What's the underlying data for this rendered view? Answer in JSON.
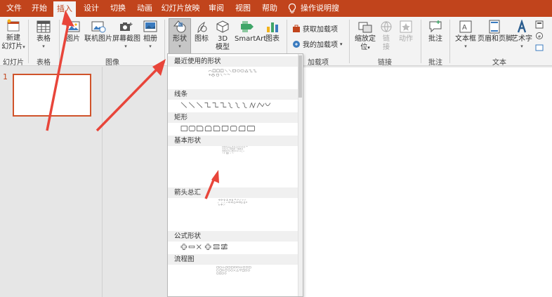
{
  "tabs": [
    {
      "id": "file",
      "label": "文件"
    },
    {
      "id": "home",
      "label": "开始"
    },
    {
      "id": "insert",
      "label": "插入",
      "active": true
    },
    {
      "id": "design",
      "label": "设计"
    },
    {
      "id": "transitions",
      "label": "切换"
    },
    {
      "id": "animations",
      "label": "动画"
    },
    {
      "id": "slideshow",
      "label": "幻灯片放映"
    },
    {
      "id": "review",
      "label": "审阅"
    },
    {
      "id": "view",
      "label": "视图"
    },
    {
      "id": "help",
      "label": "帮助"
    }
  ],
  "tell_me": "操作说明搜索",
  "ribbon": {
    "new_slide": {
      "line1": "新建",
      "line2": "幻灯片"
    },
    "table": "表格",
    "picture": "图片",
    "online_picture": "联机图片",
    "screenshot": "屏幕截图",
    "album": "相册",
    "shapes": "形状",
    "icons": "图标",
    "model3d": {
      "line1": "3D",
      "line2": "模型"
    },
    "smartart": "SmartArt",
    "chart": "图表",
    "get_addins": "获取加载项",
    "my_addins": "我的加载项",
    "zoom": {
      "line1": "缩放定",
      "line2": "位"
    },
    "link": {
      "line1": "链",
      "line2": "接"
    },
    "action": "动作",
    "comment": "批注",
    "textbox": "文本框",
    "header_footer": "页眉和页脚",
    "wordart": "艺术字",
    "groups": {
      "slides": "幻灯片",
      "tables": "表格",
      "images": "图像",
      "addins": "加载项",
      "links": "链接",
      "comments": "批注",
      "text": "文本"
    }
  },
  "slide_panel": {
    "slide_number": "1"
  },
  "dropdown": {
    "sections": [
      "最近使用的形状",
      "线条",
      "矩形",
      "基本形状",
      "箭头总汇",
      "公式形状",
      "流程图"
    ]
  },
  "colors": {
    "accent": "#c1441c",
    "arrow": "#e8453a",
    "selection": "#d0532a"
  }
}
